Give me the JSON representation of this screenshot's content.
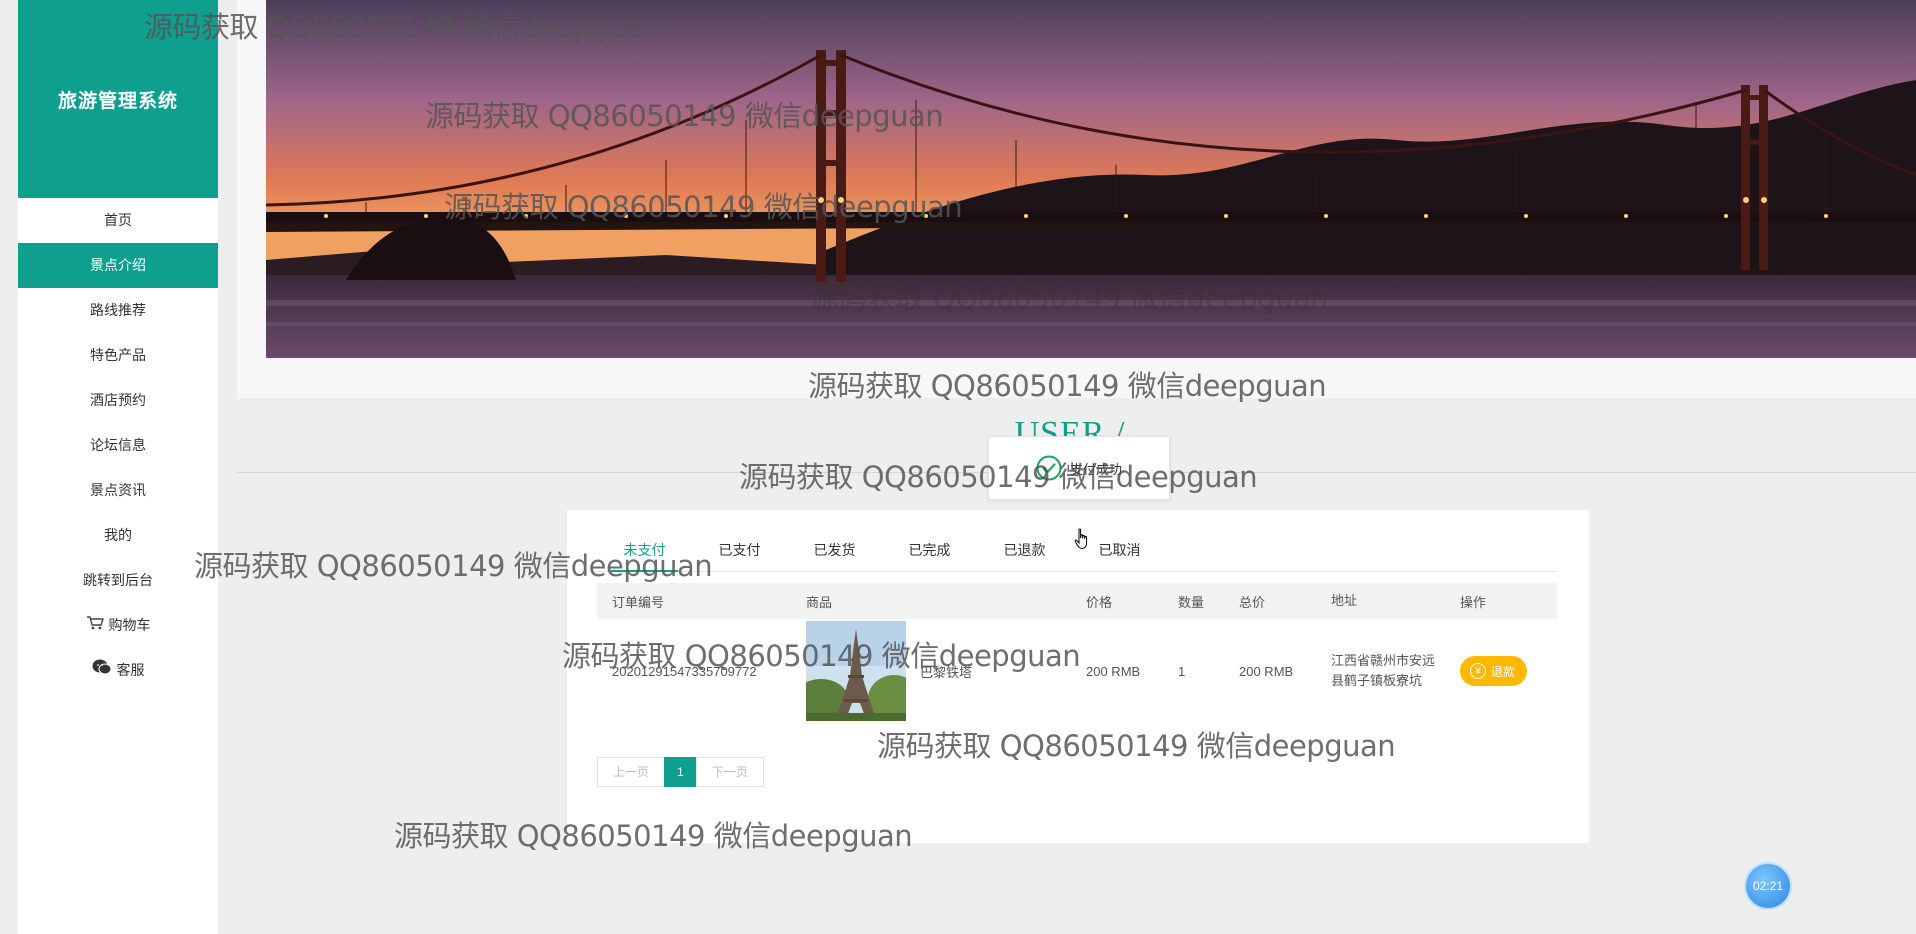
{
  "sidebar": {
    "logo": "旅游管理系统",
    "items": [
      {
        "label": "首页"
      },
      {
        "label": "景点介绍"
      },
      {
        "label": "路线推荐"
      },
      {
        "label": "特色产品"
      },
      {
        "label": "酒店预约"
      },
      {
        "label": "论坛信息"
      },
      {
        "label": "景点资讯"
      },
      {
        "label": "我的"
      },
      {
        "label": "跳转到后台"
      },
      {
        "label": "购物车",
        "icon": "cart-icon"
      },
      {
        "label": "客服",
        "icon": "chat-icon"
      }
    ],
    "active_index": 1
  },
  "banner": {
    "image": "golden-gate-bridge-sunset"
  },
  "section": {
    "title": "USER / ORDER"
  },
  "toast": {
    "message": "支付成功",
    "icon": "check-circle-icon"
  },
  "order": {
    "tabs": [
      "未支付",
      "已支付",
      "已发货",
      "已完成",
      "已退款",
      "已取消"
    ],
    "active_tab": 0,
    "columns": [
      "订单编号",
      "商品",
      "价格",
      "数量",
      "总价",
      "地址",
      "操作"
    ],
    "rows": [
      {
        "order_no": "20201291547335709772",
        "goods_name": "巴黎铁塔",
        "goods_image": "eiffel-tower-thumbnail",
        "price": "200 RMB",
        "qty": "1",
        "total": "200 RMB",
        "address": "江西省赣州市安远县鹤子镇板寮坑",
        "action": "退款"
      }
    ],
    "pager": {
      "prev": "上一页",
      "current": "1",
      "next": "下一页"
    }
  },
  "timer": {
    "text": "02:21"
  },
  "watermark": "源码获取 QQ86050149 微信deepguan",
  "colors": {
    "accent": "#0e9f8e",
    "refund": "#ffb800",
    "timer": "#2d86e0"
  }
}
